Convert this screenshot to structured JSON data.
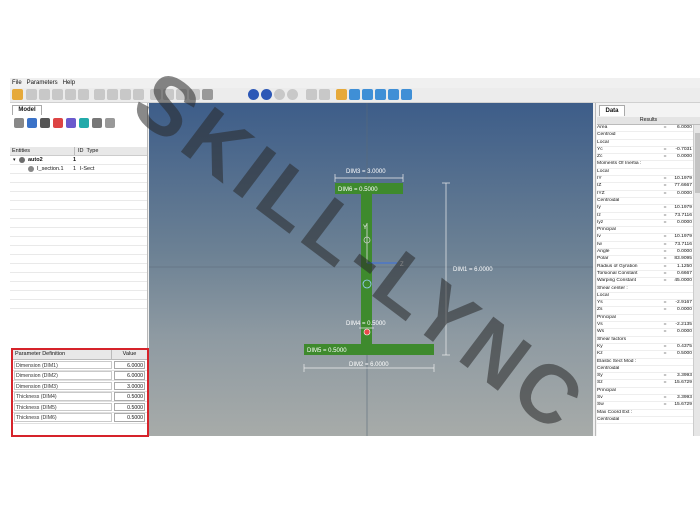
{
  "menu": [
    "File",
    "Parameters",
    "Help"
  ],
  "left": {
    "tab": "Model",
    "columns": [
      "Entities",
      "ID",
      "Type"
    ],
    "tree": [
      {
        "name": "auto2",
        "id": "1",
        "type": ""
      },
      {
        "name": "I_section.1",
        "id": "1",
        "type": "I-Sect"
      }
    ]
  },
  "params": {
    "header_name": "Parameter Definition",
    "header_value": "Value",
    "rows": [
      {
        "name": "Dimension (DIM1)",
        "value": "6.0000"
      },
      {
        "name": "Dimension (DIM2)",
        "value": "6.0000"
      },
      {
        "name": "Dimension (DIM3)",
        "value": "3.0000"
      },
      {
        "name": "Thickness (DIM4)",
        "value": "0.5000"
      },
      {
        "name": "Thickness (DIM5)",
        "value": "0.5000"
      },
      {
        "name": "Thickness (DIM6)",
        "value": "0.5000"
      }
    ]
  },
  "viewport": {
    "dim3": "DIM3 = 3.0000",
    "dim6": "DIM6 = 0.5000",
    "dim1": "DIM1 = 6.0000",
    "dim4": "DIM4 = 0.5000",
    "dim5": "DIM5 = 0.5000",
    "dim2": "DIM2 = 6.0000",
    "axis_y": "Y",
    "axis_z": "Z",
    "section_color": "#3e8a2d"
  },
  "data": {
    "tab": "Data",
    "results_header": "Results",
    "results": [
      {
        "label": "Area",
        "eq": "=",
        "value": "6.0000"
      },
      {
        "label": "Centroid",
        "eq": "",
        "value": ""
      },
      {
        "label": "  Local",
        "eq": "",
        "value": ""
      },
      {
        "label": "      Yc",
        "eq": "=",
        "value": "-0.7031"
      },
      {
        "label": "      Zc",
        "eq": "=",
        "value": "0.0000"
      },
      {
        "label": "Moments Of Inertia :",
        "eq": "",
        "value": ""
      },
      {
        "label": "  Local",
        "eq": "",
        "value": ""
      },
      {
        "label": "      IY",
        "eq": "=",
        "value": "10.1979"
      },
      {
        "label": "      IZ",
        "eq": "=",
        "value": "77.6667"
      },
      {
        "label": "      IYZ",
        "eq": "=",
        "value": "0.0000"
      },
      {
        "label": "  Centroidal",
        "eq": "",
        "value": ""
      },
      {
        "label": "      Iy",
        "eq": "=",
        "value": "10.1979"
      },
      {
        "label": "      Iz",
        "eq": "=",
        "value": "73.7116"
      },
      {
        "label": "      Iyz",
        "eq": "=",
        "value": "0.0000"
      },
      {
        "label": "  Principal",
        "eq": "",
        "value": ""
      },
      {
        "label": "      Iv",
        "eq": "=",
        "value": "10.1979"
      },
      {
        "label": "      Iw",
        "eq": "=",
        "value": "73.7116"
      },
      {
        "label": "      Angle",
        "eq": "=",
        "value": "0.0000"
      },
      {
        "label": "Polar",
        "eq": "=",
        "value": "83.9095"
      },
      {
        "label": "Radius of Gyration",
        "eq": "=",
        "value": "1.1250"
      },
      {
        "label": "Torsional Constant",
        "eq": "=",
        "value": "0.6667"
      },
      {
        "label": "Warping Constant",
        "eq": "=",
        "value": "45.0000"
      },
      {
        "label": "Shear center :",
        "eq": "",
        "value": ""
      },
      {
        "label": "  Local",
        "eq": "",
        "value": ""
      },
      {
        "label": "      Ys",
        "eq": "=",
        "value": "-2.9167"
      },
      {
        "label": "      Zs",
        "eq": "=",
        "value": "0.0000"
      },
      {
        "label": "  Principal",
        "eq": "",
        "value": ""
      },
      {
        "label": "      Vs",
        "eq": "=",
        "value": "-2.2135"
      },
      {
        "label": "      Ws",
        "eq": "=",
        "value": "0.0000"
      },
      {
        "label": "Shear factors",
        "eq": "",
        "value": ""
      },
      {
        "label": "      Ky",
        "eq": "=",
        "value": "0.4375"
      },
      {
        "label": "      Kz",
        "eq": "=",
        "value": "0.5000"
      },
      {
        "label": "Elastic Sect Mod :",
        "eq": "",
        "value": ""
      },
      {
        "label": "  Centroidal",
        "eq": "",
        "value": ""
      },
      {
        "label": "      Sy",
        "eq": "=",
        "value": "3.3993"
      },
      {
        "label": "      Sz",
        "eq": "=",
        "value": "15.6729"
      },
      {
        "label": "  Principal",
        "eq": "",
        "value": ""
      },
      {
        "label": "      Sv",
        "eq": "=",
        "value": "3.3993"
      },
      {
        "label": "      Sw",
        "eq": "=",
        "value": "15.6729"
      },
      {
        "label": "Max Coord Ext :",
        "eq": "",
        "value": ""
      },
      {
        "label": "  Centroidal",
        "eq": "",
        "value": ""
      }
    ]
  },
  "watermark": "SKILL-LYNC"
}
